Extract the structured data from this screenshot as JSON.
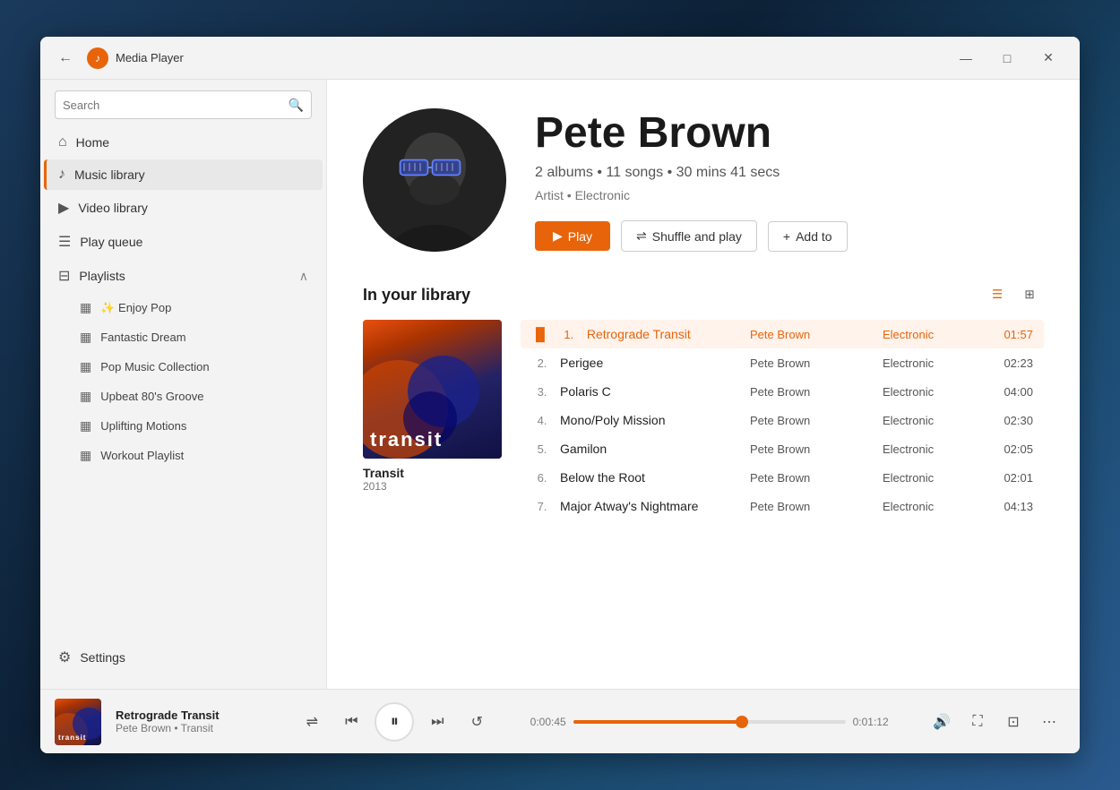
{
  "window": {
    "title": "Media Player",
    "icon": "♪"
  },
  "titlebar": {
    "back_label": "←",
    "minimize_label": "—",
    "maximize_label": "□",
    "close_label": "✕"
  },
  "search": {
    "placeholder": "Search"
  },
  "nav": {
    "home": "Home",
    "music_library": "Music library",
    "video_library": "Video library",
    "play_queue": "Play queue"
  },
  "playlists": {
    "label": "Playlists",
    "items": [
      {
        "label": "✨ Enjoy Pop"
      },
      {
        "label": "Fantastic Dream"
      },
      {
        "label": "Pop Music Collection"
      },
      {
        "label": "Upbeat 80's Groove"
      },
      {
        "label": "Uplifting Motions"
      },
      {
        "label": "Workout Playlist"
      }
    ]
  },
  "settings": {
    "label": "Settings"
  },
  "artist": {
    "name": "Pete Brown",
    "stats": "2 albums • 11 songs • 30 mins 41 secs",
    "type": "Artist • Electronic",
    "play_btn": "Play",
    "shuffle_btn": "Shuffle and play",
    "addto_btn": "Add to"
  },
  "library": {
    "title": "In your library"
  },
  "album": {
    "name": "Transit",
    "year": "2013",
    "cover_text": "transit"
  },
  "tracks": [
    {
      "num": "1.",
      "title": "Retrograde Transit",
      "artist": "Pete Brown",
      "genre": "Electronic",
      "duration": "01:57",
      "active": true
    },
    {
      "num": "2.",
      "title": "Perigee",
      "artist": "Pete Brown",
      "genre": "Electronic",
      "duration": "02:23",
      "active": false
    },
    {
      "num": "3.",
      "title": "Polaris C",
      "artist": "Pete Brown",
      "genre": "Electronic",
      "duration": "04:00",
      "active": false
    },
    {
      "num": "4.",
      "title": "Mono/Poly Mission",
      "artist": "Pete Brown",
      "genre": "Electronic",
      "duration": "02:30",
      "active": false
    },
    {
      "num": "5.",
      "title": "Gamilon",
      "artist": "Pete Brown",
      "genre": "Electronic",
      "duration": "02:05",
      "active": false
    },
    {
      "num": "6.",
      "title": "Below the Root",
      "artist": "Pete Brown",
      "genre": "Electronic",
      "duration": "02:01",
      "active": false
    },
    {
      "num": "7.",
      "title": "Major Atway's Nightmare",
      "artist": "Pete Brown",
      "genre": "Electronic",
      "duration": "04:13",
      "active": false
    }
  ],
  "player": {
    "title": "Retrograde Transit",
    "subtitle": "Pete Brown • Transit",
    "current_time": "0:00:45",
    "total_time": "0:01:12",
    "progress_pct": 62
  }
}
